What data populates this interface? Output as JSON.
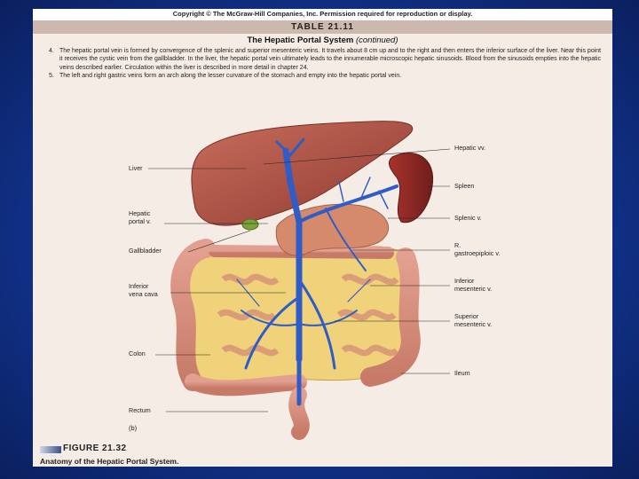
{
  "copyright": "Copyright © The McGraw-Hill Companies, Inc. Permission required for reproduction or display.",
  "table": {
    "header": "TABLE 21.11",
    "title_main": "The Hepatic Portal System ",
    "title_suffix": "(continued)",
    "paragraphs": [
      {
        "num": "4.",
        "text": "The hepatic portal vein is formed by convergence of the splenic and superior mesenteric veins. It travels about 8 cm up and to the right and then enters the inferior surface of the liver. Near this point it receives the cystic vein from the gallbladder. In the liver, the hepatic portal vein ultimately leads to the innumerable microscopic hepatic sinusoids. Blood from the sinusoids empties into the hepatic veins described earlier. Circulation within the liver is described in more detail in chapter 24."
      },
      {
        "num": "5.",
        "text": "The left and right gastric veins form an arch along the lesser curvature of the stomach and empty into the hepatic portal vein."
      }
    ]
  },
  "figure": {
    "panel": "(b)",
    "labels_left": {
      "liver": "Liver",
      "hepatic_portal_v": "Hepatic\nportal v.",
      "gallbladder": "Gallbladder",
      "inferior_vena_cava": "Inferior\nvena cava",
      "colon": "Colon",
      "rectum": "Rectum"
    },
    "labels_right": {
      "hepatic_vv": "Hepatic vv.",
      "spleen": "Spleen",
      "splenic_v": "Splenic v.",
      "r_gastroepiploic_v": "R.\ngastroepiploic v.",
      "inferior_mesenteric_v": "Inferior\nmesenteric v.",
      "superior_mesenteric_v": "Superior\nmesenteric v.",
      "ileum": "Ileum"
    },
    "figure_number": "FIGURE 21.32",
    "caption": "Anatomy of the Hepatic Portal System."
  },
  "colors": {
    "background": "#1437a0",
    "panel": "#f6ece6",
    "header_band": "#cdb8ad",
    "liver": "#b85a4a",
    "vein_blue": "#2f5cc7",
    "intestine": "#d9907e",
    "fat": "#f0d27a"
  }
}
